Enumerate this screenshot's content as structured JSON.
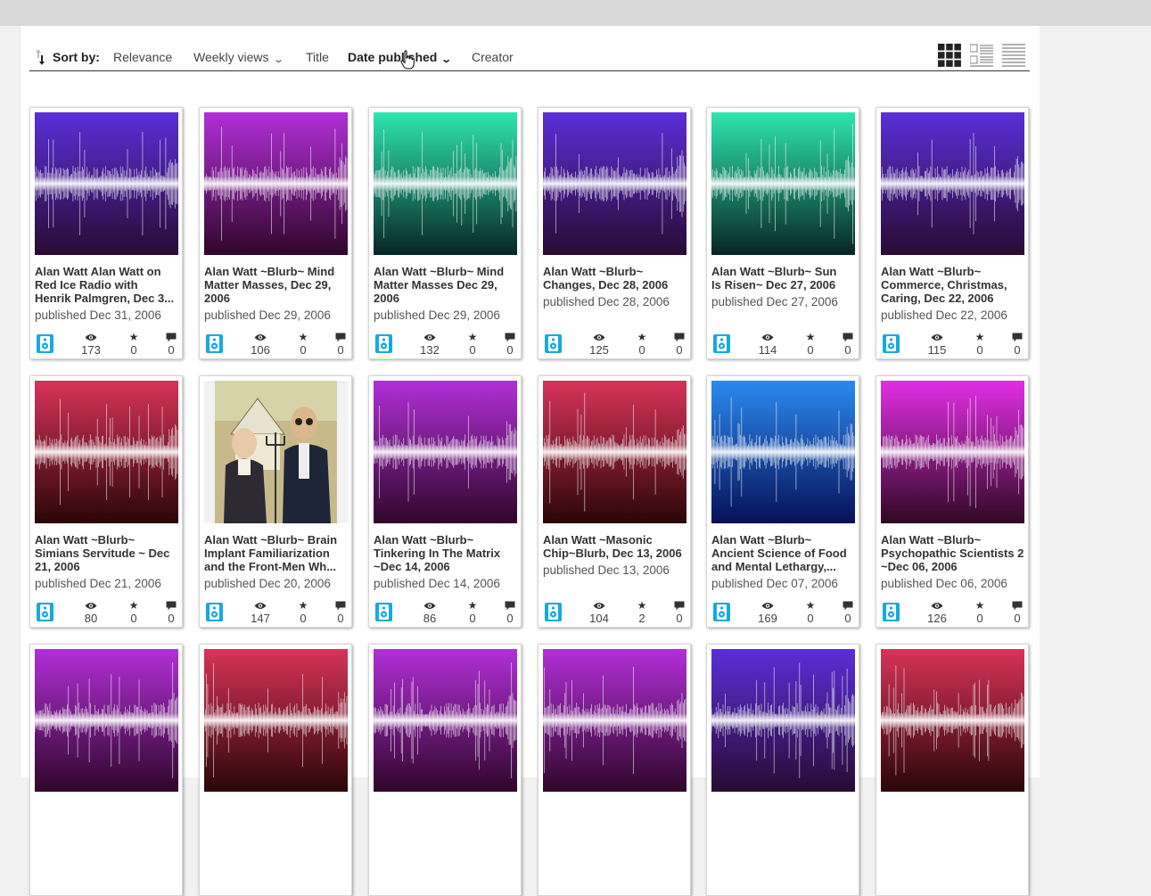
{
  "sort": {
    "label": "Sort by:",
    "options": [
      {
        "label": "Relevance"
      },
      {
        "label": "Weekly views"
      },
      {
        "label": "Title"
      },
      {
        "label": "Date published"
      },
      {
        "label": "Creator"
      }
    ],
    "active": "Date published"
  },
  "view_modes": [
    "tile-view",
    "list-detail-view",
    "list-compact-view"
  ],
  "colors": {
    "accent": "#18a9df",
    "purple": [
      "#5a2fd8",
      "#2a0a33"
    ],
    "magenta": [
      "#b12fd8",
      "#30062a"
    ],
    "teal": [
      "#2ee6b0",
      "#072526"
    ],
    "red": [
      "#d8335a",
      "#2a0606"
    ],
    "blue": [
      "#2b8af0",
      "#061058"
    ],
    "pink": [
      "#e22ee6",
      "#300822"
    ]
  },
  "items": [
    {
      "title": "Alan Watt Alan Watt on\nRed Ice Radio with\nHenrik Palmgren, Dec 3...",
      "published": "published Dec 31, 2006",
      "views": "173",
      "favorites": "0",
      "reviews": "0",
      "theme": "purple",
      "thumb": "waveform"
    },
    {
      "title": "Alan Watt ~Blurb~ Mind\nMatter Masses, Dec 29,\n2006",
      "published": "published Dec 29, 2006",
      "views": "106",
      "favorites": "0",
      "reviews": "0",
      "theme": "magenta",
      "thumb": "waveform"
    },
    {
      "title": "Alan Watt ~Blurb~ Mind\nMatter Masses Dec 29,\n2006",
      "published": "published Dec 29, 2006",
      "views": "132",
      "favorites": "0",
      "reviews": "0",
      "theme": "teal",
      "thumb": "waveform"
    },
    {
      "title": "Alan Watt ~Blurb~\nChanges, Dec 28, 2006",
      "published": "published Dec 28, 2006",
      "views": "125",
      "favorites": "0",
      "reviews": "0",
      "theme": "purple",
      "thumb": "waveform"
    },
    {
      "title": "Alan Watt ~Blurb~ Sun\nIs Risen~ Dec 27, 2006",
      "published": "published Dec 27, 2006",
      "views": "114",
      "favorites": "0",
      "reviews": "0",
      "theme": "teal",
      "thumb": "waveform"
    },
    {
      "title": "Alan Watt ~Blurb~\nCommerce, Christmas,\nCaring, Dec 22, 2006",
      "published": "published Dec 22, 2006",
      "views": "115",
      "favorites": "0",
      "reviews": "0",
      "theme": "purple",
      "thumb": "waveform"
    },
    {
      "title": "Alan Watt ~Blurb~\nSimians Servitude ~ Dec\n21, 2006",
      "published": "published Dec 21, 2006",
      "views": "80",
      "favorites": "0",
      "reviews": "0",
      "theme": "red",
      "thumb": "waveform"
    },
    {
      "title": "Alan Watt ~Blurb~ Brain\nImplant Familiarization\nand the Front-Men Wh...",
      "published": "published Dec 20, 2006",
      "views": "147",
      "favorites": "0",
      "reviews": "0",
      "theme": "photo",
      "thumb": "american-gothic-parody"
    },
    {
      "title": "Alan Watt ~Blurb~\nTinkering In The Matrix\n~Dec 14, 2006",
      "published": "published Dec 14, 2006",
      "views": "86",
      "favorites": "0",
      "reviews": "0",
      "theme": "magenta",
      "thumb": "waveform"
    },
    {
      "title": "Alan Watt ~Masonic\nChip~Blurb, Dec 13, 2006",
      "published": "published Dec 13, 2006",
      "views": "104",
      "favorites": "2",
      "reviews": "0",
      "theme": "red",
      "thumb": "waveform"
    },
    {
      "title": "Alan Watt ~Blurb~\nAncient Science of Food\nand Mental Lethargy,...",
      "published": "published Dec 07, 2006",
      "views": "169",
      "favorites": "0",
      "reviews": "0",
      "theme": "blue",
      "thumb": "waveform"
    },
    {
      "title": "Alan Watt ~Blurb~\nPsychopathic Scientists 2\n~Dec 06, 2006",
      "published": "published Dec 06, 2006",
      "views": "126",
      "favorites": "0",
      "reviews": "0",
      "theme": "pink",
      "thumb": "waveform"
    },
    {
      "title": "",
      "published": "",
      "views": "",
      "favorites": "",
      "reviews": "",
      "theme": "magenta",
      "thumb": "waveform"
    },
    {
      "title": "",
      "published": "",
      "views": "",
      "favorites": "",
      "reviews": "",
      "theme": "red",
      "thumb": "waveform"
    },
    {
      "title": "",
      "published": "",
      "views": "",
      "favorites": "",
      "reviews": "",
      "theme": "magenta",
      "thumb": "waveform"
    },
    {
      "title": "",
      "published": "",
      "views": "",
      "favorites": "",
      "reviews": "",
      "theme": "magenta",
      "thumb": "waveform"
    },
    {
      "title": "",
      "published": "",
      "views": "",
      "favorites": "",
      "reviews": "",
      "theme": "purple",
      "thumb": "waveform"
    },
    {
      "title": "",
      "published": "",
      "views": "",
      "favorites": "",
      "reviews": "",
      "theme": "red",
      "thumb": "waveform"
    }
  ]
}
